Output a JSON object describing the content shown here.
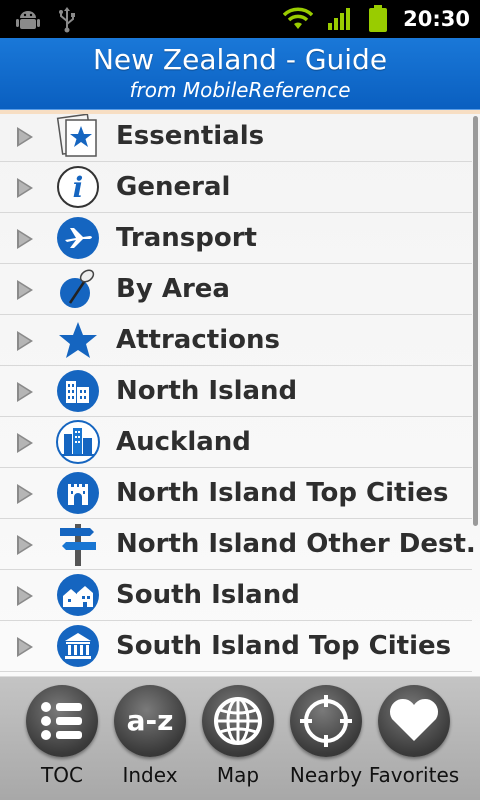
{
  "status_bar": {
    "time": "20:30",
    "icons": [
      "android-debug-icon",
      "usb-icon",
      "wifi-icon",
      "signal-icon",
      "battery-icon"
    ],
    "colors": {
      "signal": "#99cc00"
    }
  },
  "header": {
    "title": "New Zealand - Guide",
    "subtitle": "from MobileReference",
    "color": "#0a66c8"
  },
  "list": {
    "items": [
      {
        "label": "Essentials",
        "icon": "star-document-icon"
      },
      {
        "label": "General",
        "icon": "info-icon"
      },
      {
        "label": "Transport",
        "icon": "airplane-icon"
      },
      {
        "label": "By Area",
        "icon": "pushpin-icon"
      },
      {
        "label": "Attractions",
        "icon": "star-icon"
      },
      {
        "label": "North Island",
        "icon": "buildings-icon"
      },
      {
        "label": "Auckland",
        "icon": "city-icon"
      },
      {
        "label": "North Island Top Cities",
        "icon": "castle-icon"
      },
      {
        "label": "North Island Other Dest.",
        "icon": "signpost-icon"
      },
      {
        "label": "South Island",
        "icon": "houses-icon"
      },
      {
        "label": "South Island Top Cities",
        "icon": "museum-icon"
      }
    ]
  },
  "toolbar": {
    "buttons": [
      {
        "label": "TOC",
        "icon": "list-icon"
      },
      {
        "label": "Index",
        "icon": "a-z-icon"
      },
      {
        "label": "Map",
        "icon": "globe-icon"
      },
      {
        "label": "Nearby",
        "icon": "crosshair-icon"
      },
      {
        "label": "Favorites",
        "icon": "heart-icon"
      }
    ],
    "index_glyph": "a-z"
  }
}
